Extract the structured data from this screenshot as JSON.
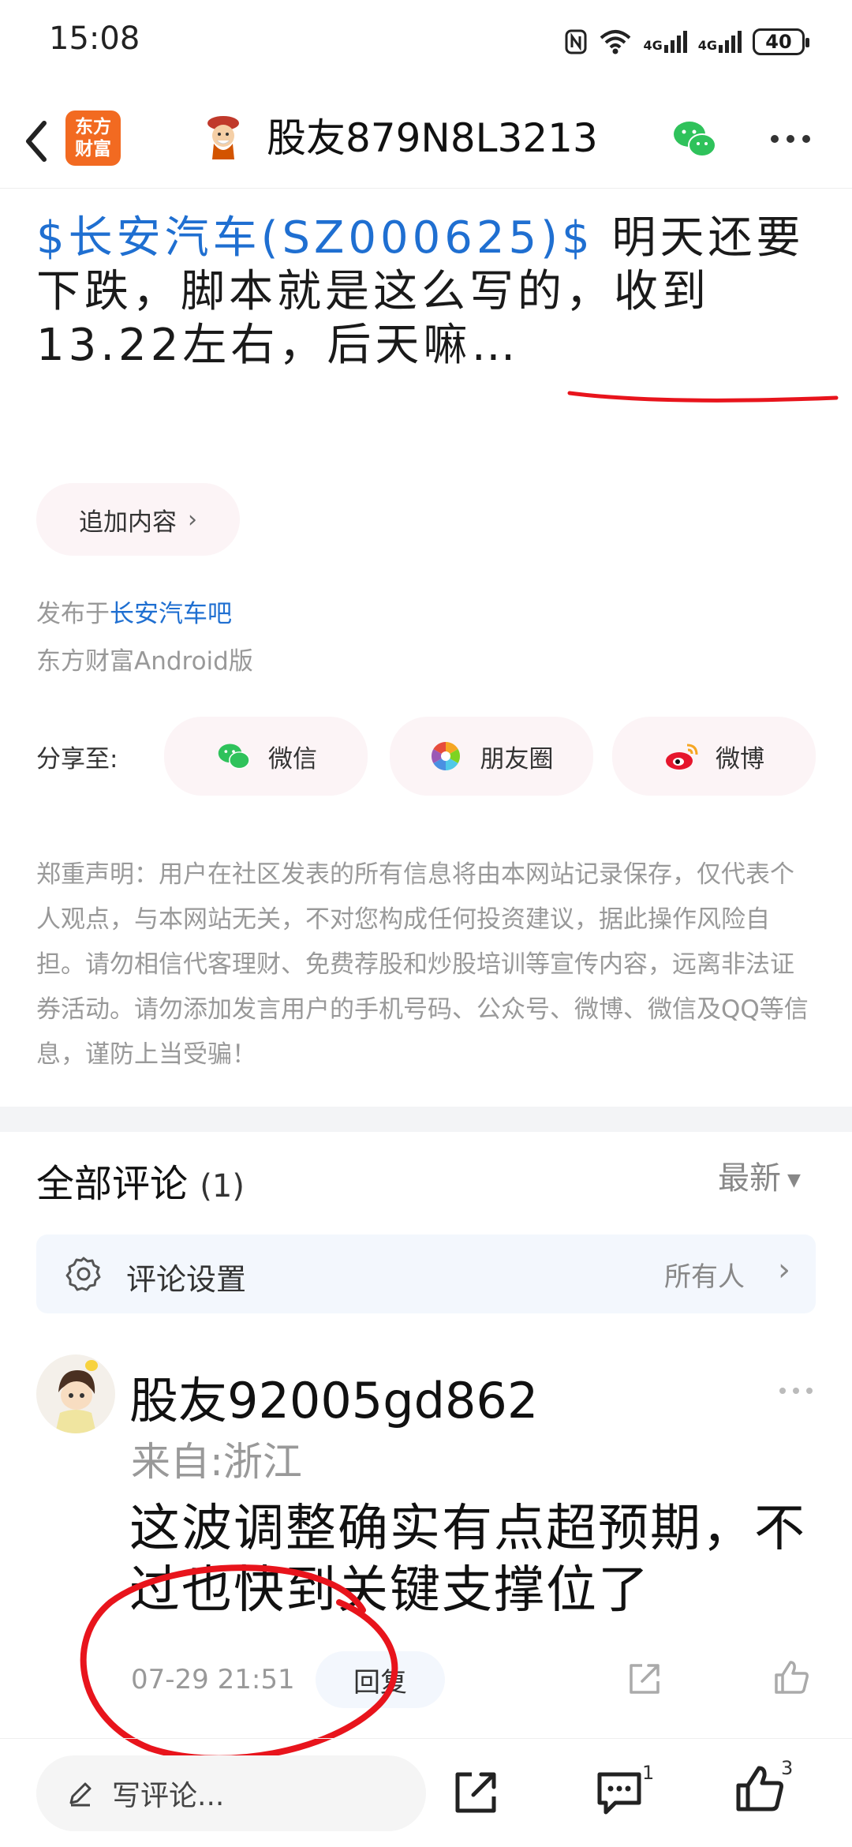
{
  "status_bar": {
    "time": "15:08",
    "battery": "40",
    "network": "4G"
  },
  "header": {
    "logo_line1": "东方",
    "logo_line2": "财富",
    "title": "股友879N8L3213"
  },
  "post": {
    "stock_tag": "$长安汽车(SZ000625)$",
    "text": " 明天还要下跌，脚本就是这么写的，收到13.22左右，后天嘛…",
    "add_content": "追加内容",
    "published_prefix": "发布于",
    "published_bar": "长安汽车吧",
    "client": "东方财富Android版"
  },
  "share": {
    "label": "分享至:",
    "wechat": "微信",
    "moments": "朋友圈",
    "weibo": "微博"
  },
  "disclaimer": "郑重声明：用户在社区发表的所有信息将由本网站记录保存，仅代表个人观点，与本网站无关，不对您构成任何投资建议，据此操作风险自担。请勿相信代客理财、免费荐股和炒股培训等宣传内容，远离非法证券活动。请勿添加发言用户的手机号码、公众号、微博、微信及QQ等信息，谨防上当受骗！",
  "comments": {
    "title": "全部评论",
    "count": "(1)",
    "sort": "最新",
    "settings_label": "评论设置",
    "settings_value": "所有人",
    "items": [
      {
        "user": "股友92005gd862",
        "location": "来自:浙江",
        "text": "这波调整确实有点超预期，不过也快到关键支撑位了",
        "time": "07-29 21:51",
        "reply": "回复"
      }
    ]
  },
  "bottom_bar": {
    "write_placeholder": "写评论...",
    "comment_count": "1",
    "like_count": "3"
  },
  "colors": {
    "link": "#1f6fd1",
    "brand": "#f26a21",
    "annotation": "#e8141c"
  }
}
